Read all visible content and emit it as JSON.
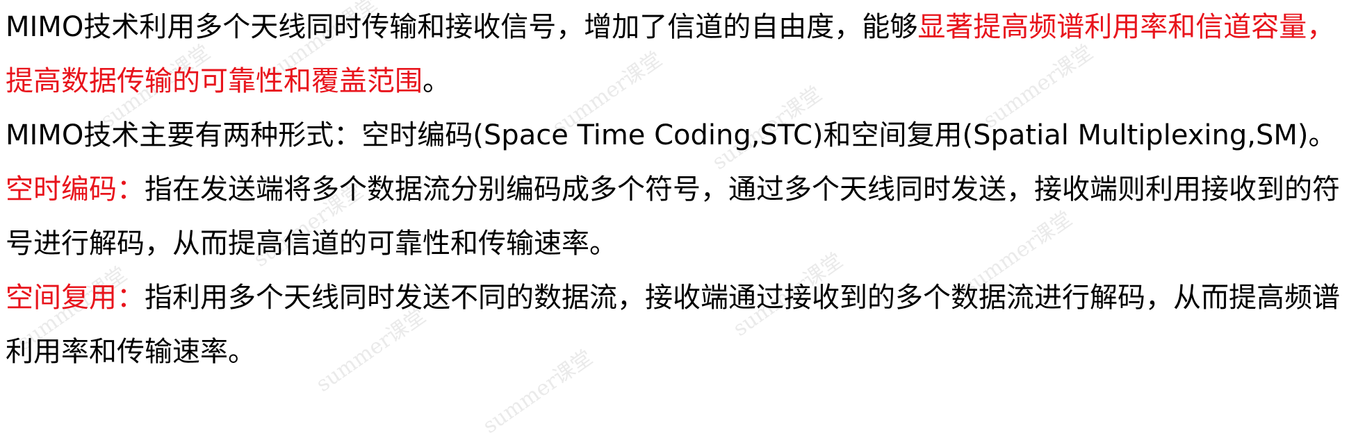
{
  "document": {
    "p1": {
      "text": "MIMO技术利用多个天线同时传输和接收信号，增加了信道的自由度，能够",
      "highlight": "显著提高频谱利用率和信道容量，提高数据传输的可靠性和覆盖范围",
      "end": "。"
    },
    "p2": {
      "text": "MIMO技术主要有两种形式：空时编码(Space Time Coding,STC)和空间复用(Spatial Multiplexing,SM)。"
    },
    "p3": {
      "label": "空时编码：",
      "text": "指在发送端将多个数据流分别编码成多个符号，通过多个天线同时发送，接收端则利用接收到的符号进行解码，从而提高信道的可靠性和传输速率。"
    },
    "p4": {
      "label": "空间复用：",
      "text": "指利用多个天线同时发送不同的数据流，接收端通过接收到的多个数据流进行解码，从而提高频谱利用率和传输速率。"
    },
    "colors": {
      "text": "#000000",
      "highlight": "#e8141c",
      "watermark": "#a0a0a0"
    }
  },
  "watermark": {
    "text": "summer课堂"
  }
}
